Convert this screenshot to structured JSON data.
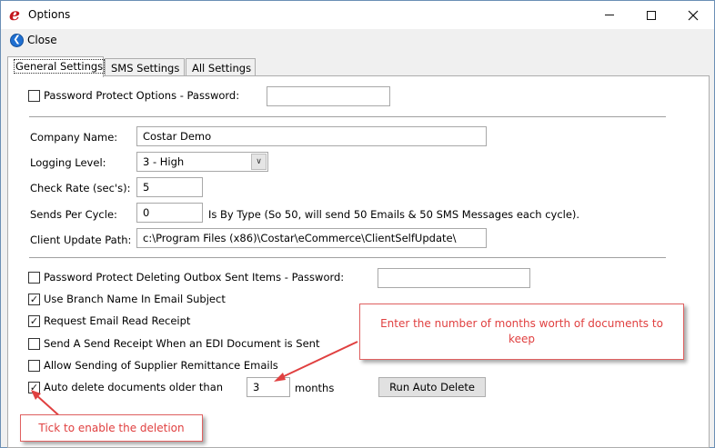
{
  "window": {
    "title": "Options",
    "icon": "e-logo-icon",
    "controls": [
      "minimize",
      "maximize",
      "close"
    ]
  },
  "toolbar": {
    "close_label": "Close"
  },
  "tabs": [
    {
      "label": "General Settings",
      "active": true
    },
    {
      "label": "SMS Settings",
      "active": false
    },
    {
      "label": "All Settings",
      "active": false
    }
  ],
  "form": {
    "password_protect_options": {
      "label": "Password Protect Options - Password:",
      "checked": false,
      "value": ""
    },
    "company_name": {
      "label": "Company Name:",
      "value": "Costar Demo"
    },
    "logging_level": {
      "label": "Logging Level:",
      "value": "3 - High"
    },
    "check_rate": {
      "label": "Check Rate (sec's):",
      "value": "5"
    },
    "sends_per_cycle": {
      "label": "Sends Per Cycle:",
      "value": "0",
      "note": "Is By Type (So 50, will send 50 Emails & 50 SMS Messages each cycle)."
    },
    "client_update_path": {
      "label": "Client Update Path:",
      "value": "c:\\Program Files (x86)\\Costar\\eCommerce\\ClientSelfUpdate\\"
    },
    "password_protect_outbox": {
      "label": "Password Protect Deleting Outbox  Sent Items - Password:",
      "checked": false,
      "value": ""
    },
    "use_branch_name": {
      "label": "Use Branch Name In Email Subject",
      "checked": true
    },
    "request_read_receipt": {
      "label": "Request Email Read Receipt",
      "checked": true
    },
    "send_receipt_edi": {
      "label": "Send A Send Receipt When an EDI Document is Sent",
      "checked": false
    },
    "allow_remittance": {
      "label": "Allow Sending of Supplier Remittance Emails",
      "checked": false
    },
    "auto_delete": {
      "label": "Auto delete documents older than",
      "checked": true,
      "value": "3",
      "unit": "months"
    },
    "run_auto_delete_label": "Run Auto Delete"
  },
  "annotations": {
    "months_callout": "Enter the number of months worth of documents to keep",
    "tick_callout": "Tick to enable the deletion",
    "color": "#e04040"
  },
  "colors": {
    "accent_blue": "#1f6fd1",
    "callout_red": "#e04040",
    "app_icon_red": "#c4161c"
  }
}
